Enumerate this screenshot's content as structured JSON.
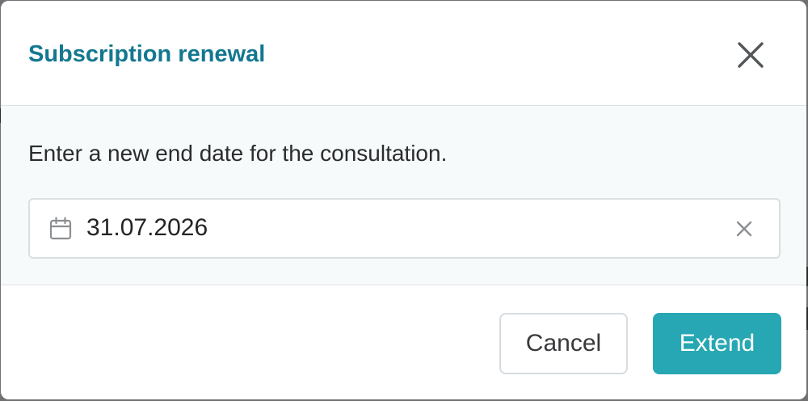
{
  "dialog": {
    "title": "Subscription renewal",
    "close_icon": "close-icon",
    "message": "Enter a new end date for the consultation.",
    "date_field": {
      "value": "31.07.2026",
      "leading_icon": "calendar-icon",
      "clear_icon": "clear-icon"
    },
    "buttons": {
      "cancel_label": "Cancel",
      "extend_label": "Extend"
    }
  },
  "colors": {
    "title": "#13788f",
    "primary_button": "#27a7b3",
    "body_background": "#f7fafa",
    "divider": "#dde3e4"
  }
}
